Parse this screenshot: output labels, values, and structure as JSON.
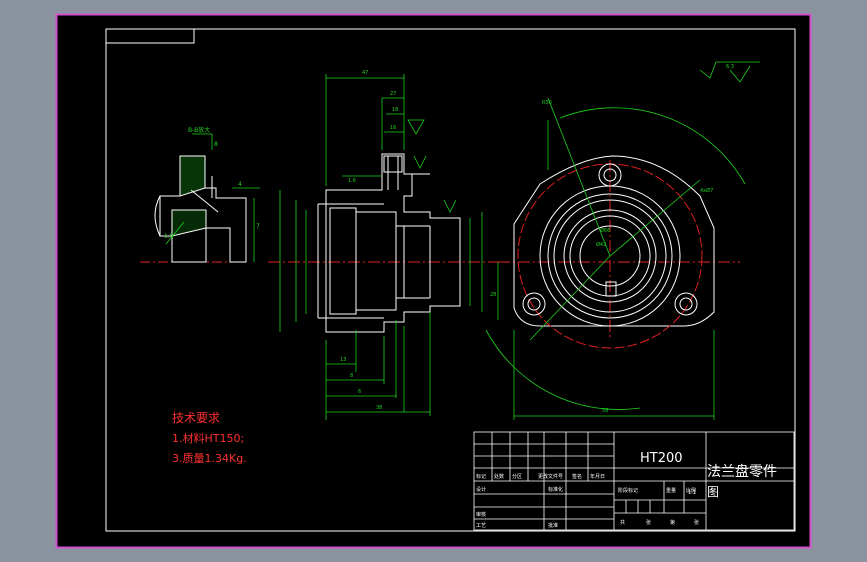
{
  "tech_requirements": {
    "heading": "技术要求",
    "line1": "1.材料HT150;",
    "line2": "3.质量1.34Kg."
  },
  "title_block": {
    "material": "HT200",
    "part_name": "法兰盘零件",
    "drawing_suffix": "图",
    "scale": "1:1",
    "revision_headers": [
      "标记",
      "处数",
      "分区",
      "更改文件号",
      "签名",
      "年月日"
    ],
    "role_labels": [
      "设计",
      "审核",
      "工艺"
    ],
    "standard_labels": [
      "标准化",
      "批准"
    ],
    "stage_headers": [
      "阶段标记",
      "重量",
      "比例"
    ],
    "sheet_labels": [
      "共",
      "张",
      "第",
      "张"
    ]
  },
  "dimensions": {
    "roughness_note": "6.3",
    "section_label": "B-B放大",
    "left_numbers": [
      "8",
      "7",
      "4",
      "1.5"
    ],
    "main_numbers": [
      "47",
      "27",
      "18",
      "16",
      "13",
      "8",
      "6",
      "1.6",
      "38"
    ],
    "right_numbers": [
      "R50",
      "4xØ7",
      "Ø66",
      "Ø42",
      "28",
      "56"
    ]
  },
  "colors": {
    "page": "#8b93a0",
    "paper": "#000000",
    "frame": "#d34fd0",
    "border": "#ffffff",
    "geometry": "#ffffff",
    "dimension": "#1fd31f",
    "centerline": "#e02020",
    "note": "#ff3030"
  }
}
